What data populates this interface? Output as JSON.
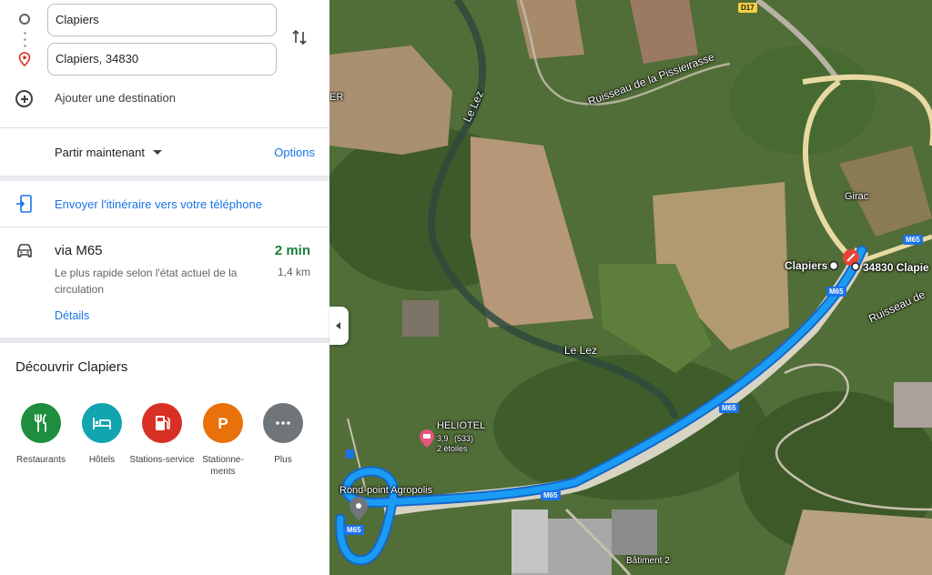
{
  "directions": {
    "origin_value": "Clapiers",
    "destination_value": "Clapiers, 34830",
    "add_destination_label": "Ajouter une destination"
  },
  "departure": {
    "leave_now_label": "Partir maintenant",
    "options_label": "Options"
  },
  "send_to_phone_label": "Envoyer l'itinéraire vers votre téléphone",
  "route": {
    "name": "via M65",
    "duration": "2 min",
    "description": "Le plus rapide selon l'état actuel de la circulation",
    "distance": "1,4 km",
    "details_label": "Détails"
  },
  "discover": {
    "title": "Découvrir Clapiers",
    "categories": [
      {
        "label": "Restaurants",
        "icon": "restaurant-icon",
        "color": "#1e8e3e"
      },
      {
        "label": "Hôtels",
        "icon": "hotel-icon",
        "color": "#12a4af"
      },
      {
        "label": "Stations-service",
        "icon": "gas-station-icon",
        "color": "#d93025"
      },
      {
        "label": "Stationne-ments",
        "icon": "parking-icon",
        "color": "#e8710a"
      },
      {
        "label": "Plus",
        "icon": "more-icon",
        "color": "#70757a"
      }
    ]
  },
  "map": {
    "labels": {
      "ruisseau_pissieirasse": "Ruisseau de la Pissieirasse",
      "ruisseau_right": "Ruisseau de",
      "le_lez_1": "Le Lez",
      "le_lez_2": "Le Lez",
      "clapiers": "Clapiers",
      "clapiers_dest": "34830 Clapie",
      "girac": "Girac",
      "heliotel": "HELIOTEL",
      "heliotel_rating": "3,9",
      "heliotel_reviews": "(533)",
      "heliotel_stars": "2 étoiles",
      "rond_point": "Rond-point Agropolis",
      "batiment": "Bâtiment 2",
      "edge_label": "ER"
    },
    "road_shields": [
      "D17",
      "M65",
      "M65",
      "M65",
      "M65",
      "M65"
    ],
    "route_color": "#1a9cf5"
  }
}
